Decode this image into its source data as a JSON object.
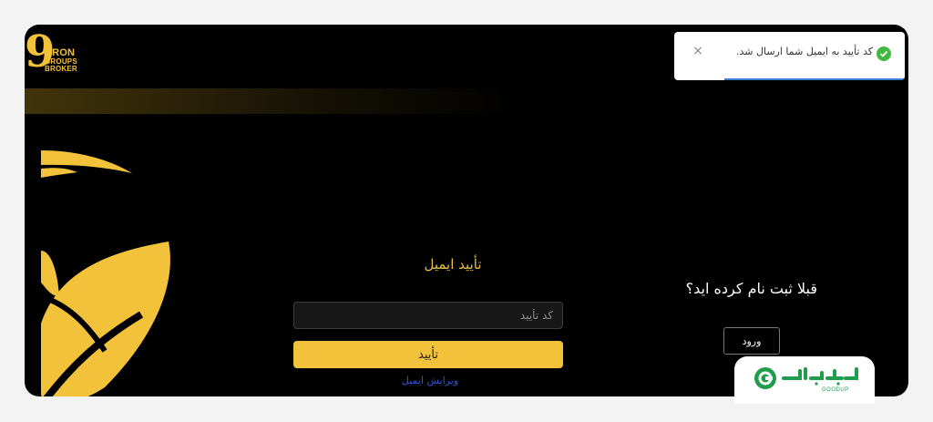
{
  "brand": {
    "logo_numeral": "9",
    "logo_line1": "ARON",
    "logo_line2": "GROUPS",
    "logo_line3": "BROKER"
  },
  "form": {
    "title": "تأیید ایمیل",
    "code_placeholder": "کد تأیید",
    "code_value": "",
    "confirm_label": "تأیید",
    "edit_email_label": "ویرایش ایمیل"
  },
  "side": {
    "question": "قبلا ثبت نام کرده اید؟",
    "login_label": "ورود"
  },
  "toast": {
    "message": "کد تأیید به ایمیل شما ارسال شد.",
    "close_symbol": "×",
    "status_icon": "check-circle-icon"
  },
  "watermark": {
    "brand_small": "GOODUP"
  },
  "colors": {
    "accent": "#f2c23a",
    "background": "#000000",
    "link": "#2f56d6",
    "success": "#3fb93f",
    "watermark": "#1f9d4b"
  }
}
